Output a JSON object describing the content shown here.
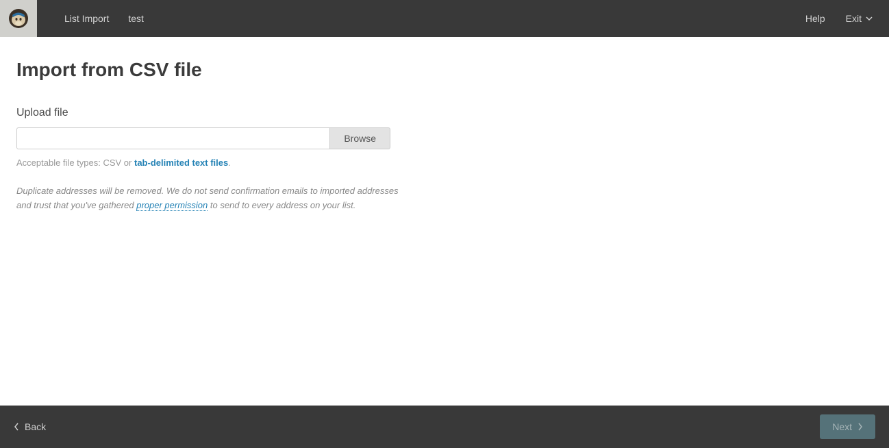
{
  "header": {
    "breadcrumb_primary": "List Import",
    "breadcrumb_secondary": "test",
    "help_label": "Help",
    "exit_label": "Exit"
  },
  "main": {
    "title": "Import from CSV file",
    "upload_label": "Upload file",
    "file_value": "",
    "browse_label": "Browse",
    "acceptable_prefix": "Acceptable file types: CSV or ",
    "acceptable_link": "tab-delimited text files",
    "acceptable_suffix": ".",
    "disclaimer_part1": "Duplicate addresses will be removed. We do not send confirmation emails to imported addresses and trust that you've gathered ",
    "disclaimer_link": "proper permission",
    "disclaimer_part2": " to send to every address on your list."
  },
  "footer": {
    "back_label": "Back",
    "next_label": "Next"
  }
}
